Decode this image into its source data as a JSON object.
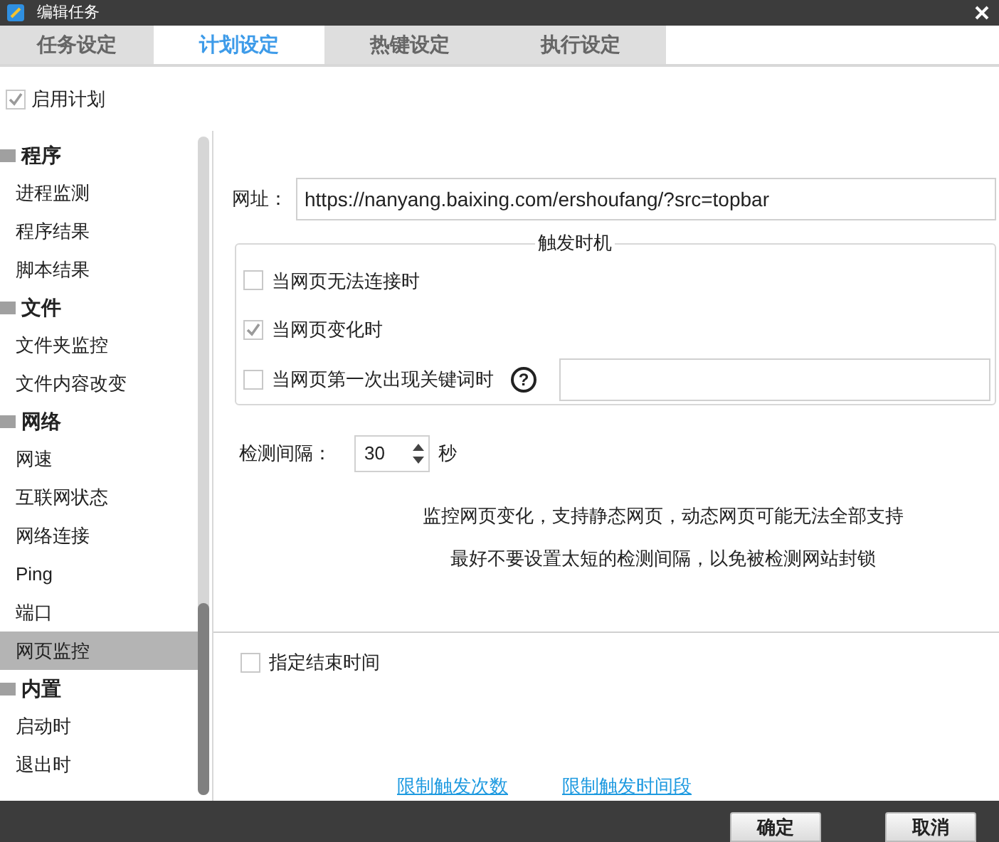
{
  "window": {
    "title": "编辑任务"
  },
  "tabs": [
    {
      "label": "任务设定",
      "selected": false
    },
    {
      "label": "计划设定",
      "selected": true
    },
    {
      "label": "热键设定",
      "selected": false
    },
    {
      "label": "执行设定",
      "selected": false
    }
  ],
  "enable_plan": {
    "label": "启用计划",
    "checked": true
  },
  "sidebar": {
    "items": [
      {
        "label": "程序",
        "expanded": true,
        "children": [
          {
            "label": "进程监测",
            "selected": false
          },
          {
            "label": "程序结果",
            "selected": false
          },
          {
            "label": "脚本结果",
            "selected": false
          }
        ]
      },
      {
        "label": "文件",
        "expanded": true,
        "children": [
          {
            "label": "文件夹监控",
            "selected": false
          },
          {
            "label": "文件内容改变",
            "selected": false
          }
        ]
      },
      {
        "label": "网络",
        "expanded": true,
        "children": [
          {
            "label": "网速",
            "selected": false
          },
          {
            "label": "互联网状态",
            "selected": false
          },
          {
            "label": "网络连接",
            "selected": false
          },
          {
            "label": "Ping",
            "selected": false
          },
          {
            "label": "端口",
            "selected": false
          },
          {
            "label": "网页监控",
            "selected": true
          }
        ]
      },
      {
        "label": "内置",
        "expanded": true,
        "children": [
          {
            "label": "启动时",
            "selected": false
          },
          {
            "label": "退出时",
            "selected": false
          }
        ]
      }
    ]
  },
  "url": {
    "label": "网址：",
    "value": "https://nanyang.baixing.com/ershoufang/?src=topbar"
  },
  "trigger": {
    "title": "触发时机",
    "options": [
      {
        "label": "当网页无法连接时",
        "checked": false
      },
      {
        "label": "当网页变化时",
        "checked": true
      },
      {
        "label": "当网页第一次出现关键词时",
        "checked": false,
        "help": "?",
        "keyword_field": true
      }
    ]
  },
  "interval": {
    "label": "检测间隔：",
    "value": "30",
    "unit": "秒"
  },
  "notes": [
    "监控网页变化，支持静态网页，动态网页可能无法全部支持",
    "最好不要设置太短的检测间隔，以免被检测网站封锁"
  ],
  "end_time": {
    "label": "指定结束时间",
    "checked": false
  },
  "links": [
    "限制触发次数",
    "限制触发时间段"
  ],
  "buttons": [
    "确定",
    "取消"
  ]
}
